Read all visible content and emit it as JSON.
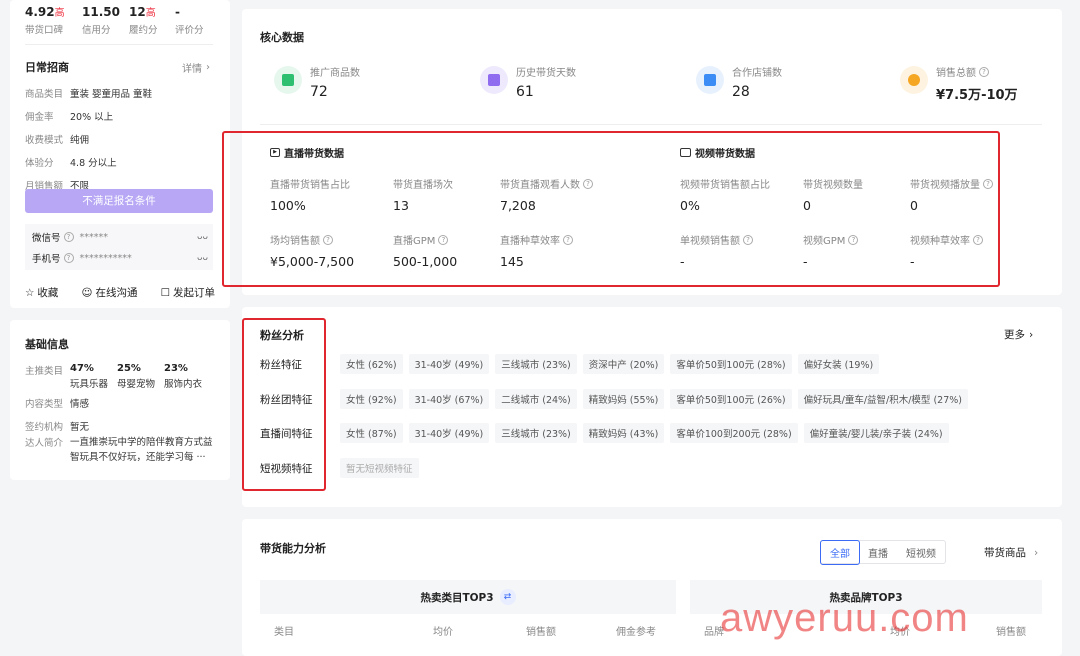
{
  "top_scores": [
    {
      "value": "4.92",
      "badge": "高",
      "label": "带货口碑"
    },
    {
      "value": "11.50",
      "badge": "",
      "label": "信用分"
    },
    {
      "value": "12",
      "badge": "高",
      "label": "履约分"
    },
    {
      "value": "-",
      "badge": "",
      "label": "评价分"
    }
  ],
  "recruit": {
    "title": "日常招商",
    "detail_link": "详情",
    "rows": [
      {
        "k": "商品类目",
        "v": "童装 婴童用品 童鞋"
      },
      {
        "k": "佣金率",
        "v": "20% 以上"
      },
      {
        "k": "收费模式",
        "v": "纯佣"
      },
      {
        "k": "体验分",
        "v": "4.8 分以上"
      },
      {
        "k": "月销售额",
        "v": "不限"
      }
    ],
    "apply_button": "不满足报名条件",
    "contacts": [
      {
        "label": "微信号",
        "value": "******"
      },
      {
        "label": "手机号",
        "value": "***********"
      }
    ],
    "actions": [
      "收藏",
      "在线沟通",
      "发起订单"
    ]
  },
  "basic": {
    "title": "基础信息",
    "main_category_label": "主推类目",
    "categories": [
      {
        "pct": "47%",
        "name": "玩具乐器"
      },
      {
        "pct": "25%",
        "name": "母婴宠物"
      },
      {
        "pct": "23%",
        "name": "服饰内衣"
      }
    ],
    "rows": [
      {
        "k": "内容类型",
        "v": "情感"
      },
      {
        "k": "签约机构",
        "v": "暂无"
      }
    ],
    "intro_label": "达人简介",
    "intro_text": "一直推崇玩中学的陪伴教育方式益智玩具不仅好玩，还能学习每 ···"
  },
  "core": {
    "title": "核心数据",
    "stats": [
      {
        "label": "推广商品数",
        "value": "72",
        "color": "#2fbf71"
      },
      {
        "label": "历史带货天数",
        "value": "61",
        "color": "#8f6bf0"
      },
      {
        "label": "合作店铺数",
        "value": "28",
        "color": "#3b8cf5"
      },
      {
        "label": "销售总额",
        "value": "¥7.5万-10万",
        "color": "#f5a623"
      }
    ],
    "live_title": "直播带货数据",
    "video_title": "视频带货数据",
    "live_metrics": [
      {
        "label": "直播带货销售占比",
        "value": "100%",
        "q": false
      },
      {
        "label": "带货直播场次",
        "value": "13",
        "q": false
      },
      {
        "label": "带货直播观看人数",
        "value": "7,208",
        "q": true
      },
      {
        "label": "场均销售额",
        "value": "¥5,000-7,500",
        "q": true
      },
      {
        "label": "直播GPM",
        "value": "500-1,000",
        "q": true
      },
      {
        "label": "直播种草效率",
        "value": "145",
        "q": true
      }
    ],
    "video_metrics": [
      {
        "label": "视频带货销售额占比",
        "value": "0%",
        "q": false
      },
      {
        "label": "带货视频数量",
        "value": "0",
        "q": false
      },
      {
        "label": "带货视频播放量",
        "value": "0",
        "q": true
      },
      {
        "label": "单视频销售额",
        "value": "-",
        "q": true
      },
      {
        "label": "视频GPM",
        "value": "-",
        "q": true
      },
      {
        "label": "视频种草效率",
        "value": "-",
        "q": true
      }
    ]
  },
  "fans": {
    "title": "粉丝分析",
    "more": "更多",
    "rows": [
      {
        "label": "粉丝特征",
        "tags": [
          "女性 (62%)",
          "31-40岁 (49%)",
          "三线城市 (23%)",
          "资深中产 (20%)",
          "客单价50到100元 (28%)",
          "偏好女装 (19%)"
        ]
      },
      {
        "label": "粉丝团特征",
        "tags": [
          "女性 (92%)",
          "31-40岁 (67%)",
          "二线城市 (24%)",
          "精致妈妈 (55%)",
          "客单价50到100元 (26%)",
          "偏好玩具/童车/益智/积木/模型 (27%)"
        ]
      },
      {
        "label": "直播间特征",
        "tags": [
          "女性 (87%)",
          "31-40岁 (49%)",
          "三线城市 (23%)",
          "精致妈妈 (43%)",
          "客单价100到200元 (28%)",
          "偏好童装/婴儿装/亲子装 (24%)"
        ]
      },
      {
        "label": "短视频特征",
        "tags": [
          "暂无短视频特征"
        ]
      }
    ]
  },
  "ability": {
    "title": "带货能力分析",
    "segments": [
      "全部",
      "直播",
      "短视频"
    ],
    "goods_link": "带货商品",
    "top_category_title": "热卖类目TOP3",
    "top_brand_title": "热卖品牌TOP3",
    "category_headers": [
      "类目",
      "均价",
      "销售额",
      "佣金参考"
    ],
    "brand_headers": [
      "品牌",
      "均价",
      "销售额"
    ]
  },
  "watermark": "awyeruu.com"
}
